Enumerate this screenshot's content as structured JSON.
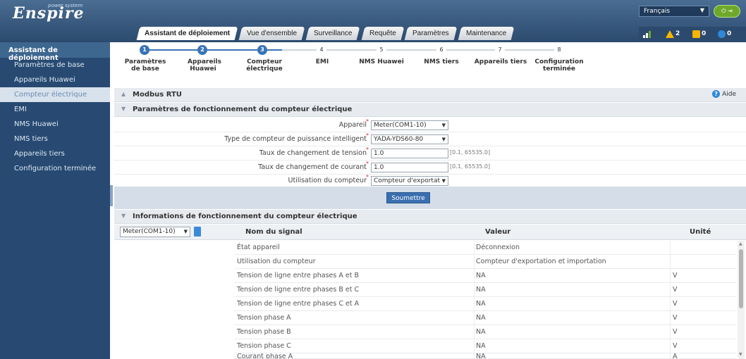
{
  "header": {
    "logo": "Enspire",
    "logo_sub": "power system",
    "language": "Français",
    "nav_tabs": [
      "Assistant de déploiement",
      "Vue d'ensemble",
      "Surveillance",
      "Requête",
      "Paramètres",
      "Maintenance"
    ],
    "active_tab": "Assistant de déploiement",
    "alarms": {
      "major": "2",
      "minor": "0",
      "info": "0"
    },
    "accent_color": "#3973b8",
    "header_color": "#2b4a6e"
  },
  "sidebar": {
    "title": "Assistant de déploiement",
    "items": [
      {
        "label": "Paramètres de base",
        "active": false
      },
      {
        "label": "Appareils Huawei",
        "active": false
      },
      {
        "label": "Compteur électrique",
        "active": true
      },
      {
        "label": "EMI",
        "active": false
      },
      {
        "label": "NMS Huawei",
        "active": false
      },
      {
        "label": "NMS tiers",
        "active": false
      },
      {
        "label": "Appareils tiers",
        "active": false
      },
      {
        "label": "Configuration terminée",
        "active": false
      }
    ]
  },
  "steps": [
    {
      "num": "1",
      "label": "Paramètres de base",
      "done": true
    },
    {
      "num": "2",
      "label": "Appareils Huawei",
      "done": true
    },
    {
      "num": "3",
      "label": "Compteur électrique",
      "done": true
    },
    {
      "num": "4",
      "label": "EMI",
      "done": false
    },
    {
      "num": "5",
      "label": "NMS Huawei",
      "done": false
    },
    {
      "num": "6",
      "label": "NMS tiers",
      "done": false
    },
    {
      "num": "7",
      "label": "Appareils tiers",
      "done": false
    },
    {
      "num": "8",
      "label": "Configuration terminée",
      "done": false
    }
  ],
  "modbus": {
    "title": "Modbus RTU",
    "help": "Aide"
  },
  "params": {
    "title": "Paramètres de fonctionnement du compteur électrique",
    "fields": [
      {
        "label": "Appareil",
        "type": "select",
        "value": "Meter(COM1-10)"
      },
      {
        "label": "Type de compteur de puissance intelligent",
        "type": "select",
        "value": "YADA-YDS60-80"
      },
      {
        "label": "Taux de changement de tension",
        "type": "input",
        "value": "1.0",
        "range": "[0.1, 65535.0]"
      },
      {
        "label": "Taux de changement de courant",
        "type": "input",
        "value": "1.0",
        "range": "[0.1, 65535.0]"
      },
      {
        "label": "Utilisation du compteur",
        "type": "select",
        "value": "Compteur d'exportat"
      }
    ],
    "submit": "Soumettre"
  },
  "info": {
    "title": "Informations de fonctionnement du compteur électrique",
    "device": "Meter(COM1-10)",
    "columns": [
      "Nom du signal",
      "Valeur",
      "Unité"
    ],
    "rows": [
      [
        "État appareil",
        "Déconnexion",
        ""
      ],
      [
        "Utilisation du compteur",
        "Compteur d'exportation et importation",
        ""
      ],
      [
        "Tension de ligne entre phases A et B",
        "NA",
        "V"
      ],
      [
        "Tension de ligne entre phases B et C",
        "NA",
        "V"
      ],
      [
        "Tension de ligne entre phases C et A",
        "NA",
        "V"
      ],
      [
        "Tension phase A",
        "NA",
        "V"
      ],
      [
        "Tension phase B",
        "NA",
        "V"
      ],
      [
        "Tension phase C",
        "NA",
        "V"
      ],
      [
        "Courant phase A",
        "NA",
        "A"
      ]
    ]
  }
}
